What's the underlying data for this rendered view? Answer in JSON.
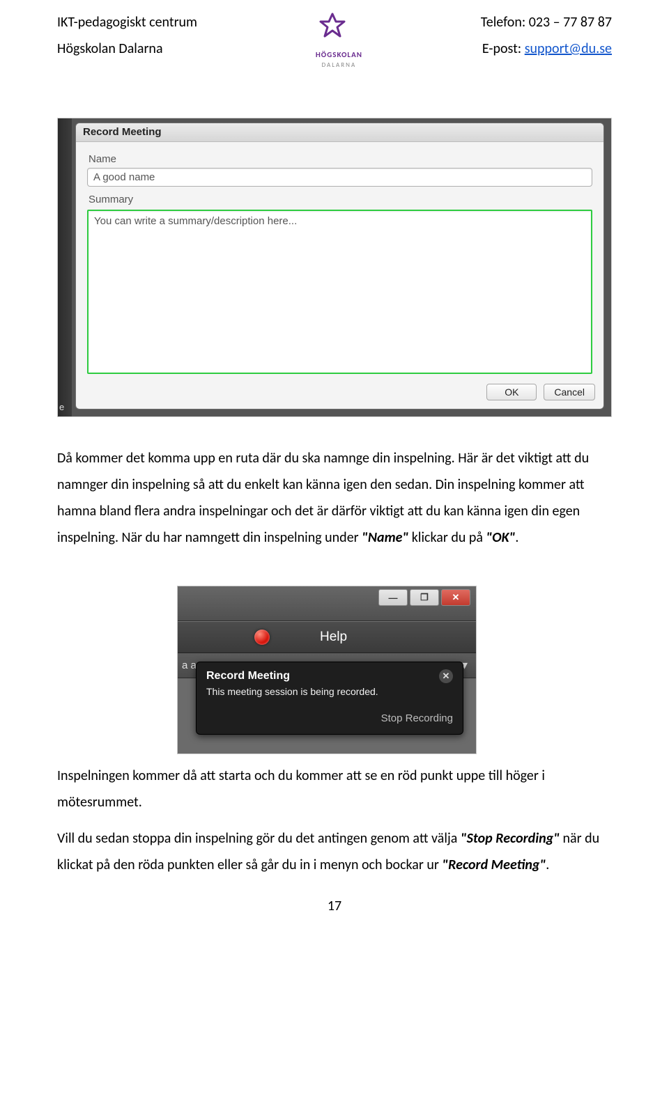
{
  "header": {
    "left_line1": "IKT-pedagogiskt centrum",
    "left_line2": "Högskolan Dalarna",
    "right_line1": "Telefon: 023 – 77 87 87",
    "right_line2_prefix": "E-post: ",
    "right_line2_link": "support@du.se",
    "logo_text": "HÖGSKOLAN",
    "logo_sub": "DALARNA"
  },
  "dialog": {
    "title": "Record Meeting",
    "name_label": "Name",
    "name_value": "A good name",
    "summary_label": "Summary",
    "summary_value": "You can write a summary/description here...",
    "ok_label": "OK",
    "cancel_label": "Cancel",
    "edge_char": "e"
  },
  "para1_pre": "Då kommer det komma upp en ruta där du ska namnge din inspelning. Här är det viktigt att du namnger din inspelning så att du enkelt kan känna igen den sedan. Din inspelning kommer att hamna bland flera andra inspelningar och det är därför viktigt att du kan känna igen din egen inspelning. När du har namngett din inspelning under ",
  "para1_q1": "\"Name\"",
  "para1_mid": " klickar du på ",
  "para1_q2": "\"OK\"",
  "para1_end": ".",
  "toast": {
    "help": "Help",
    "under_left": "a ar",
    "min_icon": "—",
    "max_icon": "❐",
    "close_icon": "✕",
    "drop_icon": "▾",
    "menu_icon": "≡",
    "title": "Record Meeting",
    "msg": "This meeting session is being recorded.",
    "stop": "Stop Recording",
    "close_glyph": "✕"
  },
  "para2": "Inspelningen kommer då att starta och du kommer att se en röd punkt uppe till höger i mötesrummet.",
  "para3_pre": "Vill du sedan stoppa din inspelning gör du det antingen genom att välja ",
  "para3_q1": "\"Stop Recording\"",
  "para3_mid": " när du klickat på den röda punkten eller så går du in i menyn och bockar ur ",
  "para3_q2": "\"Record Meeting\"",
  "para3_end": ".",
  "page_number": "17"
}
